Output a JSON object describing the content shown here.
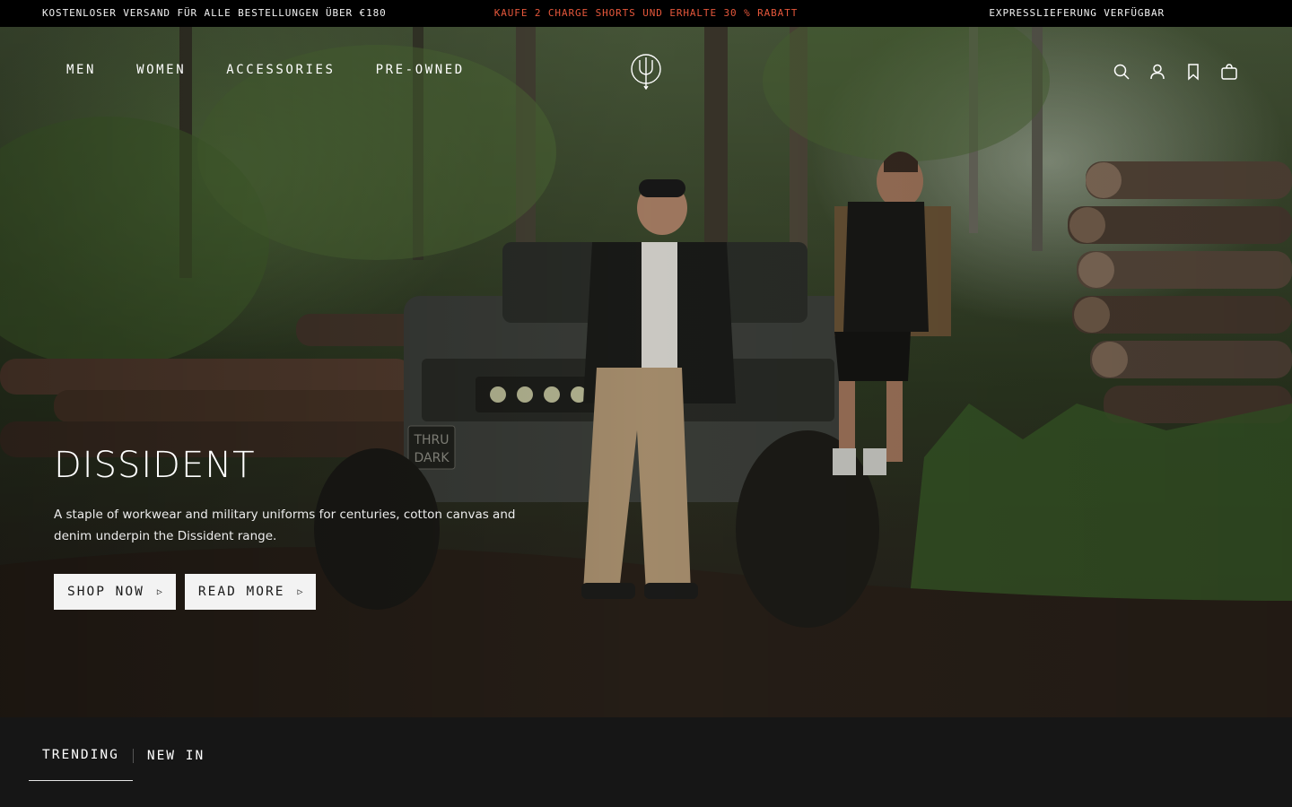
{
  "announcement": {
    "left": "KOSTENLOSER VERSAND FÜR ALLE BESTELLUNGEN ÜBER €180",
    "center": "KAUFE 2 CHARGE SHORTS UND ERHALTE 30 % RABATT",
    "right": "EXPRESSLIEFERUNG VERFÜGBAR",
    "accent_color": "#e5573b"
  },
  "nav": {
    "items": [
      {
        "label": "MEN"
      },
      {
        "label": "WOMEN"
      },
      {
        "label": "ACCESSORIES"
      },
      {
        "label": "PRE-OWNED"
      }
    ],
    "icons": [
      "search-icon",
      "account-icon",
      "wishlist-icon",
      "cart-icon"
    ],
    "logo": "trident-logo"
  },
  "hero": {
    "title": "DISSIDENT",
    "description": "A staple of workwear and military uniforms for centuries, cotton canvas and denim underpin the Dissident range.",
    "buttons": [
      {
        "label": "SHOP NOW",
        "icon": "play-arrow-icon"
      },
      {
        "label": "READ MORE",
        "icon": "play-arrow-icon"
      }
    ],
    "plate_text": [
      "THRU",
      "DARK"
    ]
  },
  "tabs": [
    {
      "label": "TRENDING",
      "active": true
    },
    {
      "label": "NEW IN",
      "active": false
    }
  ],
  "colors": {
    "background_dark": "#161616",
    "button_bg": "#f3f3f3",
    "button_text": "#1a1a1a"
  }
}
